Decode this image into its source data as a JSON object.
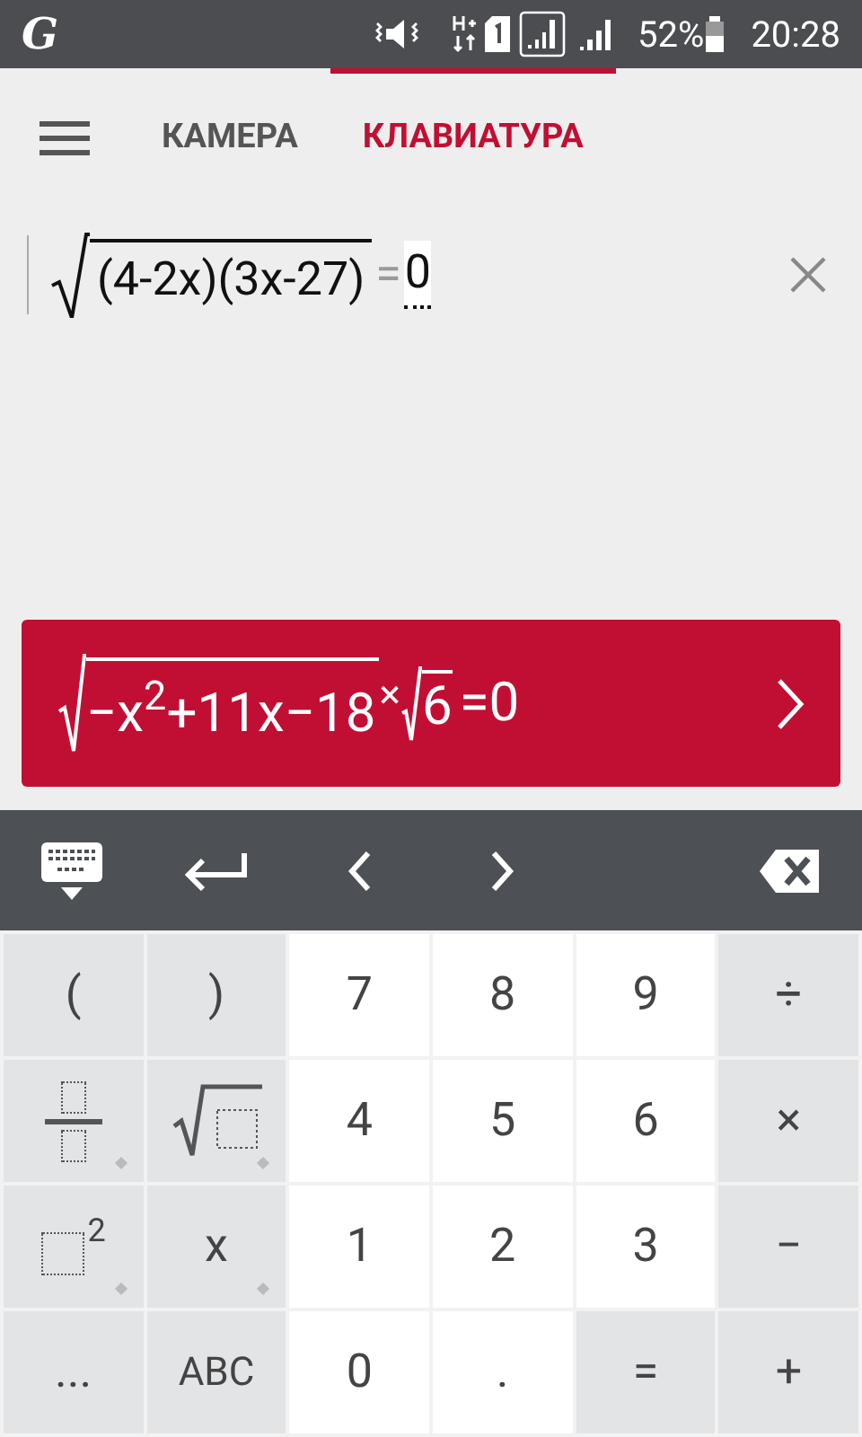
{
  "status_bar": {
    "logo": "G",
    "battery": "52%",
    "time": "20:28"
  },
  "tabs": [
    {
      "label": "КАМЕРА",
      "selected": false
    },
    {
      "label": "КЛАВИАТУРА",
      "selected": true
    }
  ],
  "input": {
    "radicand": "(4-2x)(3x-27)",
    "equals": "=",
    "rhs": "0"
  },
  "result": {
    "radicand": "−x$^{2}$+11x−18",
    "times": "×",
    "root": "6",
    "rhs": "=0"
  },
  "keys": [
    [
      {
        "kind": "text",
        "label": "(",
        "dark": true
      },
      {
        "kind": "text",
        "label": ")",
        "dark": true
      },
      {
        "kind": "text",
        "label": "7",
        "dark": false
      },
      {
        "kind": "text",
        "label": "8",
        "dark": false
      },
      {
        "kind": "text",
        "label": "9",
        "dark": false
      },
      {
        "kind": "text",
        "label": "÷",
        "dark": true
      }
    ],
    [
      {
        "kind": "fraction",
        "dark": true,
        "more": true
      },
      {
        "kind": "sqrt",
        "dark": true,
        "more": true
      },
      {
        "kind": "text",
        "label": "4",
        "dark": false
      },
      {
        "kind": "text",
        "label": "5",
        "dark": false
      },
      {
        "kind": "text",
        "label": "6",
        "dark": false
      },
      {
        "kind": "text",
        "label": "×",
        "dark": true
      }
    ],
    [
      {
        "kind": "power",
        "label": "2",
        "dark": true,
        "more": true
      },
      {
        "kind": "text",
        "label": "x",
        "dark": true,
        "more": true
      },
      {
        "kind": "text",
        "label": "1",
        "dark": false
      },
      {
        "kind": "text",
        "label": "2",
        "dark": false
      },
      {
        "kind": "text",
        "label": "3",
        "dark": false
      },
      {
        "kind": "text",
        "label": "−",
        "dark": true
      }
    ],
    [
      {
        "kind": "text",
        "label": "...",
        "dark": true
      },
      {
        "kind": "text",
        "label": "ABC",
        "dark": true,
        "small": true
      },
      {
        "kind": "text",
        "label": "0",
        "dark": false
      },
      {
        "kind": "text",
        "label": ".",
        "dark": false
      },
      {
        "kind": "text",
        "label": "=",
        "dark": true
      },
      {
        "kind": "text",
        "label": "+",
        "dark": true
      }
    ]
  ]
}
